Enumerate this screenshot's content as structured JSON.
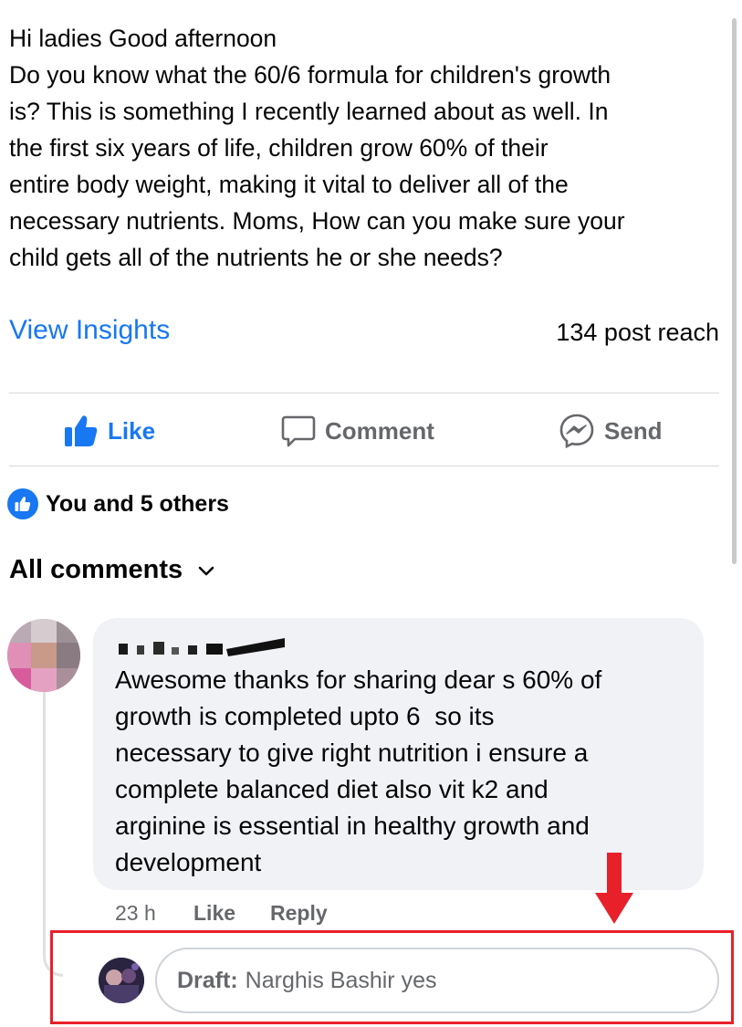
{
  "post": {
    "lines": [
      "Hi ladies Good afternoon",
      "Do you know what the 60/6 formula for children's growth",
      "is? This is something I recently learned about as well. In",
      "the first six years of life, children grow 60% of their",
      "entire body weight, making it vital to deliver all of the",
      "necessary nutrients. Moms, How can you make sure your",
      "child gets all of the nutrients he or she needs?"
    ]
  },
  "insights": {
    "link": "View Insights",
    "reach": "134 post reach"
  },
  "actions": {
    "like": "Like",
    "comment": "Comment",
    "send": "Send"
  },
  "reactions": {
    "summary": "You and 5 others",
    "icon": "thumbs-up-icon"
  },
  "comments_header": {
    "label": "All comments",
    "icon": "chevron-down-icon"
  },
  "comment": {
    "lines": [
      "Awesome thanks for sharing dear s 60% of",
      "growth is completed upto 6  so its",
      "necessary to give right nutrition i ensure a",
      "complete balanced diet also vit k2 and",
      "arginine is essential in healthy growth and",
      "development"
    ],
    "time": "23 h",
    "like": "Like",
    "reply": "Reply"
  },
  "draft": {
    "label": "Draft:",
    "text": "Narghis Bashir yes"
  },
  "colors": {
    "accent": "#1877f2",
    "highlight": "#e8202a",
    "muted": "#65676b"
  }
}
